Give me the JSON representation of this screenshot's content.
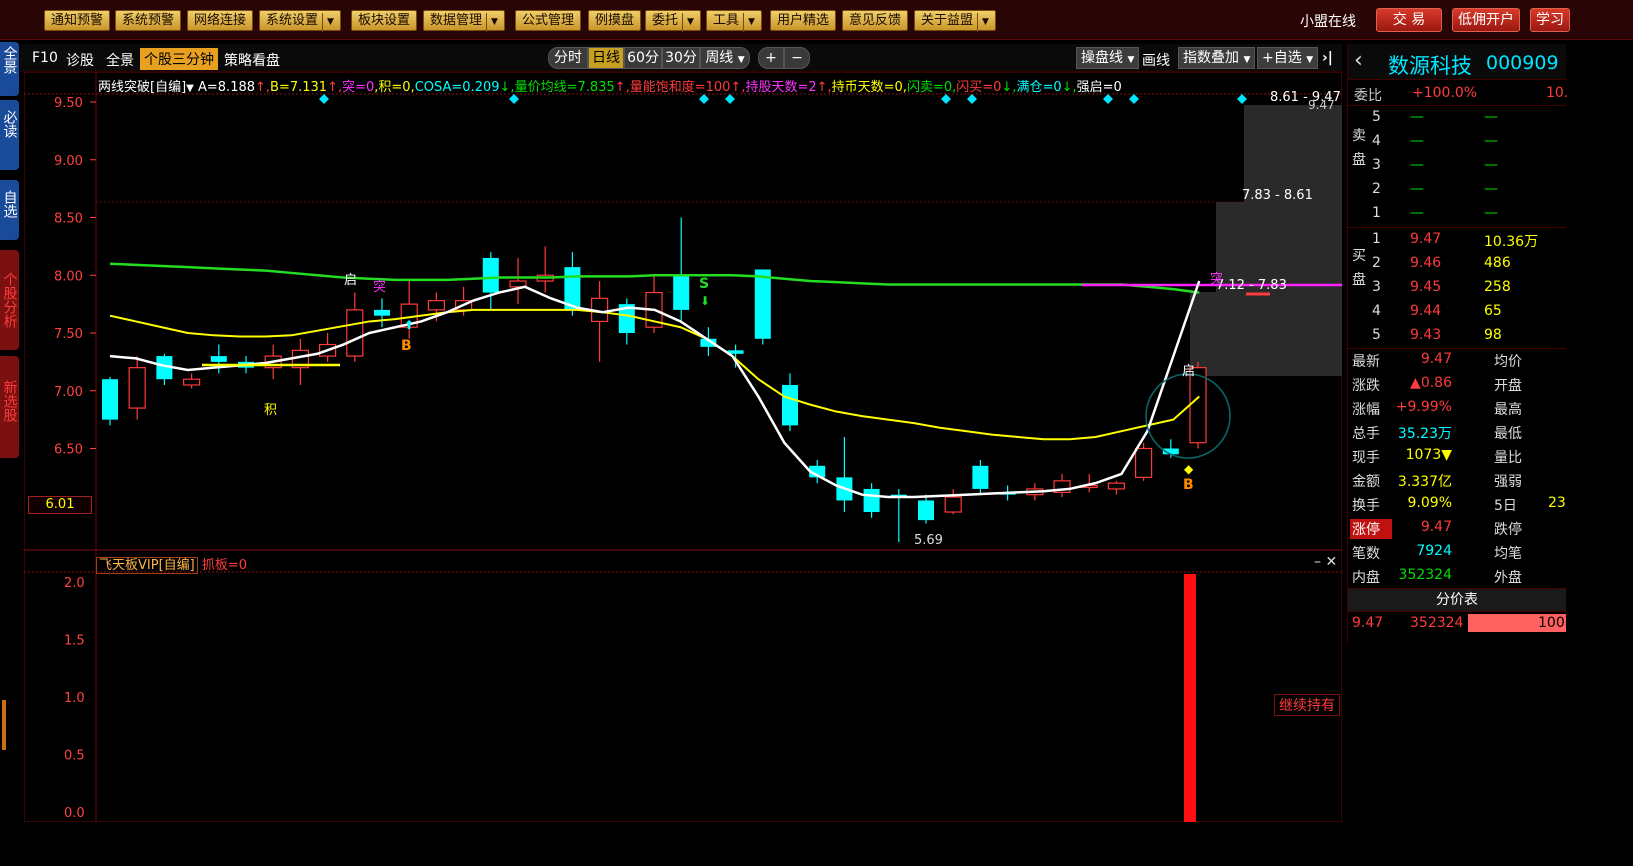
{
  "topbar": {
    "menus": [
      "通知预警",
      "系统预警",
      "网络连接",
      "系统设置",
      "板块设置",
      "数据管理",
      "公式管理",
      "例摸盘",
      "委托",
      "工具",
      "用户精选",
      "意见反馈",
      "关于益盟"
    ],
    "online": "小盟在线",
    "trade": "交 易",
    "open_account": "低佣开户",
    "learn": "学习"
  },
  "lefttabs": [
    "全景",
    "必读",
    "自选",
    "个股分析",
    "新选股"
  ],
  "toolbar": {
    "f10": "F10",
    "diag": "诊股",
    "panorama": "全景",
    "three_min": "个股三分钟",
    "strategy": "策略看盘",
    "periods": [
      "分时",
      "日线",
      "60分",
      "30分",
      "周线"
    ],
    "plus": "+",
    "minus": "−",
    "drawline_menu": "操盘线",
    "draw": "画线",
    "index_overlay": "指数叠加",
    "add_fav": "+自选",
    "close": "✕"
  },
  "formula": {
    "name": "两线突破[自编]",
    "parts": [
      {
        "text": "A=8.188",
        "color": "#ffffff"
      },
      {
        "text": "↑,",
        "color": "#ff3b3b"
      },
      {
        "text": "B=7.131",
        "color": "#ffff00"
      },
      {
        "text": "↑,",
        "color": "#ff3b3b"
      },
      {
        "text": "突=0",
        "color": "#ff33ff"
      },
      {
        "text": ",积=0,",
        "color": "#ffff00"
      },
      {
        "text": "COSA=0.209",
        "color": "#00ffff"
      },
      {
        "text": "↓,",
        "color": "#00e000"
      },
      {
        "text": "量价均线=7.835",
        "color": "#00e000"
      },
      {
        "text": "↑,",
        "color": "#ff3b3b"
      },
      {
        "text": "量能饱和度=100",
        "color": "#ff3b3b"
      },
      {
        "text": "↑,",
        "color": "#ff3b3b"
      },
      {
        "text": "持股天数=2",
        "color": "#ff33ff"
      },
      {
        "text": "↑,",
        "color": "#ff3b3b"
      },
      {
        "text": "持币天数=0,",
        "color": "#ffff00"
      },
      {
        "text": "闪卖=0,",
        "color": "#00e000"
      },
      {
        "text": "闪买=0",
        "color": "#ff3b3b"
      },
      {
        "text": "↓,",
        "color": "#00e000"
      },
      {
        "text": "满仓=0",
        "color": "#00ffff"
      },
      {
        "text": "↓,",
        "color": "#00e000"
      },
      {
        "text": "强启=0",
        "color": "#ffffff"
      }
    ]
  },
  "axis": {
    "main_ticks": [
      "9.50",
      "9.00",
      "8.50",
      "8.00",
      "7.50",
      "7.00",
      "6.50"
    ],
    "current_box": "6.01",
    "sub_ticks": [
      "2.0",
      "1.5",
      "1.0",
      "0.5",
      "0.0"
    ]
  },
  "annotations": {
    "low_label": "5.69",
    "box_top": "8.61 - 9.47",
    "box_top2": "9.47",
    "box_mid": "7.83 - 8.61",
    "box_low": "7.12 - 7.83",
    "tu": "突",
    "qi": "启",
    "ji": "积",
    "buy": "B",
    "sell": "S"
  },
  "subchart": {
    "name": "飞天板VIP[自编]",
    "value": "抓板=0",
    "hold_label": "继续持有"
  },
  "chart_data": {
    "type": "candlestick",
    "ylim": [
      5.5,
      9.6
    ],
    "candles": [
      {
        "o": 6.75,
        "c": 7.1,
        "h": 7.12,
        "l": 6.7,
        "up": false
      },
      {
        "o": 6.85,
        "c": 7.2,
        "h": 7.3,
        "l": 6.75,
        "up": true
      },
      {
        "o": 7.3,
        "c": 7.1,
        "h": 7.32,
        "l": 7.05,
        "up": false
      },
      {
        "o": 7.05,
        "c": 7.1,
        "h": 7.15,
        "l": 7.02,
        "up": true
      },
      {
        "o": 7.3,
        "c": 7.25,
        "h": 7.4,
        "l": 7.15,
        "up": false
      },
      {
        "o": 7.2,
        "c": 7.25,
        "h": 7.3,
        "l": 7.15,
        "up": false
      },
      {
        "o": 7.2,
        "c": 7.3,
        "h": 7.4,
        "l": 7.1,
        "up": true
      },
      {
        "o": 7.2,
        "c": 7.35,
        "h": 7.45,
        "l": 7.05,
        "up": true
      },
      {
        "o": 7.3,
        "c": 7.4,
        "h": 7.5,
        "l": 7.25,
        "up": true
      },
      {
        "o": 7.3,
        "c": 7.7,
        "h": 7.85,
        "l": 7.25,
        "up": true
      },
      {
        "o": 7.7,
        "c": 7.65,
        "h": 7.8,
        "l": 7.55,
        "up": false
      },
      {
        "o": 7.55,
        "c": 7.75,
        "h": 7.95,
        "l": 7.45,
        "up": true
      },
      {
        "o": 7.7,
        "c": 7.78,
        "h": 7.85,
        "l": 7.6,
        "up": true
      },
      {
        "o": 7.7,
        "c": 7.78,
        "h": 7.9,
        "l": 7.65,
        "up": true
      },
      {
        "o": 8.15,
        "c": 7.85,
        "h": 8.2,
        "l": 7.7,
        "up": false
      },
      {
        "o": 7.9,
        "c": 7.95,
        "h": 8.15,
        "l": 7.75,
        "up": true
      },
      {
        "o": 7.95,
        "c": 8.0,
        "h": 8.25,
        "l": 7.85,
        "up": true
      },
      {
        "o": 8.07,
        "c": 7.7,
        "h": 8.2,
        "l": 7.65,
        "up": false
      },
      {
        "o": 7.6,
        "c": 7.8,
        "h": 7.95,
        "l": 7.25,
        "up": true
      },
      {
        "o": 7.75,
        "c": 7.5,
        "h": 7.8,
        "l": 7.4,
        "up": false
      },
      {
        "o": 7.55,
        "c": 7.85,
        "h": 8.0,
        "l": 7.5,
        "up": true
      },
      {
        "o": 8.0,
        "c": 7.7,
        "h": 8.5,
        "l": 7.6,
        "up": false
      },
      {
        "o": 7.45,
        "c": 7.38,
        "h": 7.55,
        "l": 7.3,
        "up": false
      },
      {
        "o": 7.35,
        "c": 7.32,
        "h": 7.4,
        "l": 7.2,
        "up": false
      },
      {
        "o": 8.05,
        "c": 7.45,
        "h": 8.05,
        "l": 7.4,
        "up": false
      },
      {
        "o": 7.05,
        "c": 6.7,
        "h": 7.15,
        "l": 6.65,
        "up": false
      },
      {
        "o": 6.35,
        "c": 6.25,
        "h": 6.4,
        "l": 6.2,
        "up": false
      },
      {
        "o": 6.25,
        "c": 6.05,
        "h": 6.6,
        "l": 5.95,
        "up": false
      },
      {
        "o": 6.15,
        "c": 5.95,
        "h": 6.2,
        "l": 5.9,
        "up": false
      },
      {
        "o": 6.1,
        "c": 6.08,
        "h": 6.15,
        "l": 5.69,
        "up": false
      },
      {
        "o": 6.05,
        "c": 5.88,
        "h": 6.1,
        "l": 5.85,
        "up": false
      },
      {
        "o": 5.95,
        "c": 6.08,
        "h": 6.15,
        "l": 5.93,
        "up": true
      },
      {
        "o": 6.35,
        "c": 6.15,
        "h": 6.4,
        "l": 6.1,
        "up": false
      },
      {
        "o": 6.12,
        "c": 6.1,
        "h": 6.18,
        "l": 6.05,
        "up": false
      },
      {
        "o": 6.1,
        "c": 6.15,
        "h": 6.2,
        "l": 6.05,
        "up": true
      },
      {
        "o": 6.12,
        "c": 6.22,
        "h": 6.28,
        "l": 6.08,
        "up": true
      },
      {
        "o": 6.18,
        "c": 6.17,
        "h": 6.28,
        "l": 6.12,
        "up": true
      },
      {
        "o": 6.15,
        "c": 6.2,
        "h": 6.22,
        "l": 6.1,
        "up": true
      },
      {
        "o": 6.25,
        "c": 6.5,
        "h": 6.55,
        "l": 6.22,
        "up": true
      },
      {
        "o": 6.45,
        "c": 6.5,
        "h": 6.58,
        "l": 6.42,
        "up": false
      },
      {
        "o": 6.55,
        "c": 7.2,
        "h": 7.25,
        "l": 6.5,
        "up": true
      }
    ],
    "white_line": [
      7.3,
      7.28,
      7.22,
      7.18,
      7.2,
      7.22,
      7.24,
      7.28,
      7.32,
      7.4,
      7.5,
      7.55,
      7.6,
      7.68,
      7.78,
      7.85,
      7.9,
      7.8,
      7.72,
      7.68,
      7.72,
      7.7,
      7.6,
      7.45,
      7.3,
      6.95,
      6.55,
      6.3,
      6.18,
      6.1,
      6.08,
      6.08,
      6.09,
      6.1,
      6.11,
      6.12,
      6.13,
      6.15,
      6.2,
      6.28,
      6.65,
      7.3,
      7.95
    ],
    "yellow_line": [
      7.65,
      7.6,
      7.55,
      7.5,
      7.48,
      7.47,
      7.47,
      7.48,
      7.52,
      7.56,
      7.6,
      7.62,
      7.65,
      7.68,
      7.7,
      7.7,
      7.7,
      7.7,
      7.7,
      7.68,
      7.65,
      7.6,
      7.55,
      7.45,
      7.3,
      7.1,
      6.95,
      6.88,
      6.82,
      6.78,
      6.75,
      6.72,
      6.68,
      6.65,
      6.62,
      6.6,
      6.58,
      6.58,
      6.6,
      6.65,
      6.7,
      6.75,
      6.95
    ],
    "green_line": [
      8.1,
      8.09,
      8.08,
      8.07,
      8.06,
      8.05,
      8.04,
      8.02,
      8.0,
      7.98,
      7.97,
      7.96,
      7.96,
      7.96,
      7.97,
      7.98,
      7.98,
      7.98,
      7.99,
      7.99,
      7.99,
      8.0,
      8.0,
      8.0,
      8.0,
      7.99,
      7.97,
      7.95,
      7.94,
      7.93,
      7.92,
      7.92,
      7.92,
      7.92,
      7.92,
      7.92,
      7.92,
      7.92,
      7.92,
      7.92,
      7.9,
      7.88,
      7.85
    ]
  },
  "rpanel": {
    "back": "‹",
    "name": "数源科技",
    "code": "000909",
    "weibi_label": "委比",
    "weibi_value": "+100.0%",
    "weibi_extra": "10.",
    "sell_side": "卖盘",
    "buy_side": "买盘",
    "sell_levels": [
      {
        "n": "5",
        "p": "—",
        "v": "—"
      },
      {
        "n": "4",
        "p": "—",
        "v": "—"
      },
      {
        "n": "3",
        "p": "—",
        "v": "—"
      },
      {
        "n": "2",
        "p": "—",
        "v": "—"
      },
      {
        "n": "1",
        "p": "—",
        "v": "—"
      }
    ],
    "buy_levels": [
      {
        "n": "1",
        "p": "9.47",
        "v": "10.36万"
      },
      {
        "n": "2",
        "p": "9.46",
        "v": "486"
      },
      {
        "n": "3",
        "p": "9.45",
        "v": "258"
      },
      {
        "n": "4",
        "p": "9.44",
        "v": "65"
      },
      {
        "n": "5",
        "p": "9.43",
        "v": "98"
      }
    ],
    "stats": [
      {
        "l": "最新",
        "v": "9.47",
        "vc": "red",
        "l2": "均价"
      },
      {
        "l": "涨跌",
        "v": "▲0.86",
        "vc": "red",
        "l2": "开盘"
      },
      {
        "l": "涨幅",
        "v": "+9.99%",
        "vc": "red",
        "l2": "最高"
      },
      {
        "l": "总手",
        "v": "35.23万",
        "vc": "cyan",
        "l2": "最低"
      },
      {
        "l": "现手",
        "v": "1073▼",
        "vc": "yellow",
        "l2": "量比"
      },
      {
        "l": "金额",
        "v": "3.337亿",
        "vc": "yellow",
        "l2": "强弱"
      },
      {
        "l": "换手",
        "v": "9.09%",
        "vc": "yellow",
        "l2": "5日",
        "extra": "23"
      },
      {
        "l": "涨停",
        "v": "9.47",
        "vc": "red",
        "l2": "跌停",
        "hl": true
      },
      {
        "l": "笔数",
        "v": "7924",
        "vc": "cyan",
        "l2": "均笔"
      },
      {
        "l": "内盘",
        "v": "352324",
        "vc": "green",
        "l2": "外盘"
      }
    ],
    "fenjia_title": "分价表",
    "fenjia_price": "9.47",
    "fenjia_vol": "352324",
    "fenjia_pct": "100"
  },
  "colors": {
    "up": "#ff3b3b",
    "down": "#00ffff",
    "white_line": "#ffffff",
    "yellow_line": "#ffff00",
    "green_line": "#22dd22",
    "magenta_line": "#ff22ff"
  }
}
